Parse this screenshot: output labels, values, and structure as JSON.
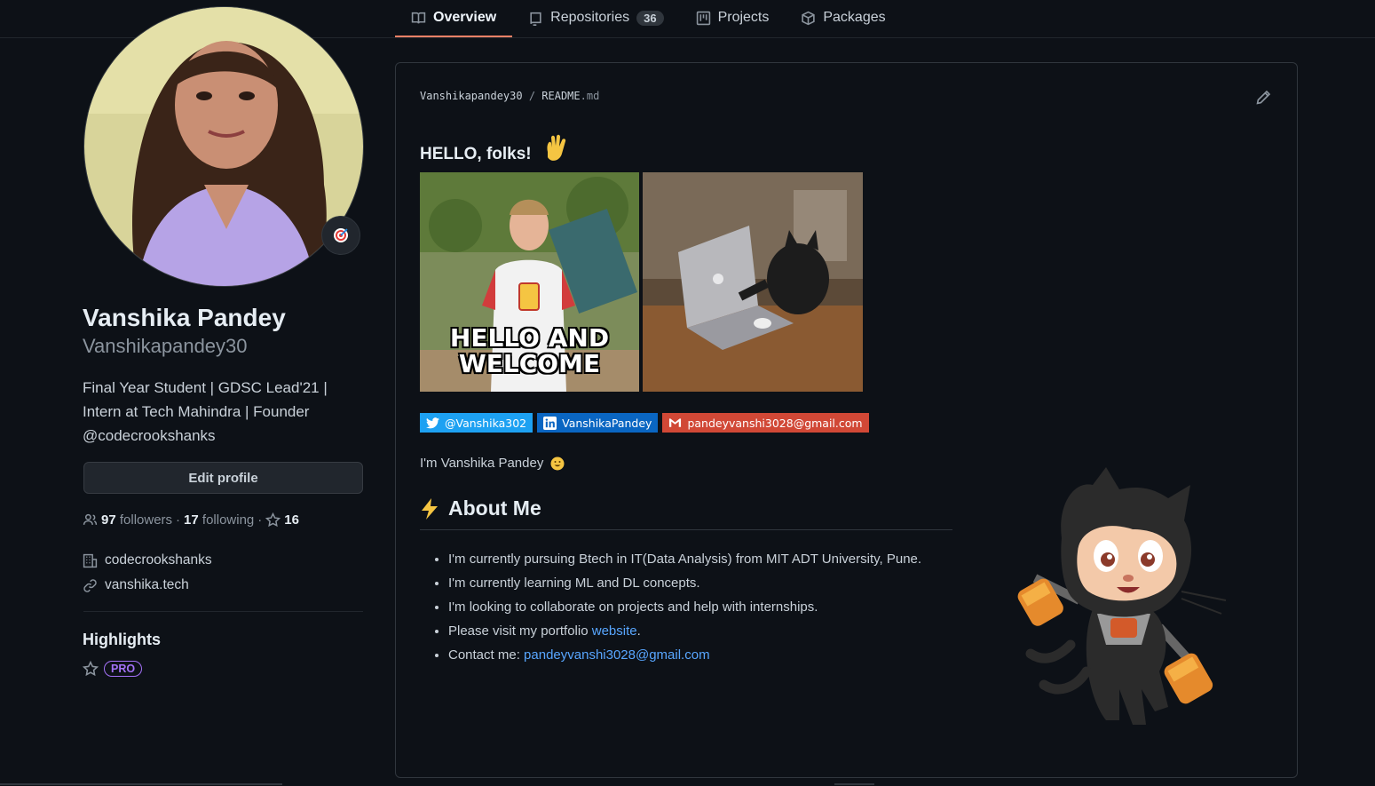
{
  "nav": {
    "tabs": [
      {
        "label": "Overview",
        "icon": "book-icon",
        "active": true
      },
      {
        "label": "Repositories",
        "icon": "repo-icon",
        "count": "36"
      },
      {
        "label": "Projects",
        "icon": "project-icon"
      },
      {
        "label": "Packages",
        "icon": "package-icon"
      }
    ]
  },
  "profile": {
    "name": "Vanshika Pandey",
    "login": "Vanshikapandey30",
    "bio_lines": [
      "Final Year Student | GDSC Lead'21 |",
      "Intern at Tech Mahindra | Founder",
      "@codecrookshanks"
    ],
    "edit_label": "Edit profile",
    "followers_count": "97",
    "followers_label": "followers",
    "following_count": "17",
    "following_label": "following",
    "stars_count": "16",
    "organization": "codecrookshanks",
    "website": "vanshika.tech",
    "highlights_title": "Highlights",
    "pro_label": "PRO"
  },
  "readme": {
    "owner": "Vanshikapandey30",
    "file_name": "README",
    "file_ext": ".md",
    "greeting": "HELLO, folks!",
    "gif1_caption_line1": "HELLO AND",
    "gif1_caption_line2": "WELCOME",
    "badges": {
      "twitter": "@Vanshika302",
      "linkedin": "VanshikaPandey",
      "gmail": "pandeyvanshi3028@gmail.com"
    },
    "intro": "I'm Vanshika Pandey",
    "about_title": "About Me",
    "bullets": {
      "b1": "I'm currently pursuing Btech in IT(Data Analysis) from MIT ADT University, Pune.",
      "b2": "I'm currently learning ML and DL concepts.",
      "b3": "I'm looking to collaborate on projects and help with internships.",
      "b4_prefix": "Please visit my portfolio ",
      "b4_link": "website",
      "b4_suffix": ".",
      "b5_prefix": "Contact me: ",
      "b5_link": "pandeyvanshi3028@gmail.com"
    }
  },
  "colors": {
    "background": "#0d1117",
    "accent_tab": "#f78166",
    "link": "#58a6ff",
    "pro": "#a371f7"
  }
}
